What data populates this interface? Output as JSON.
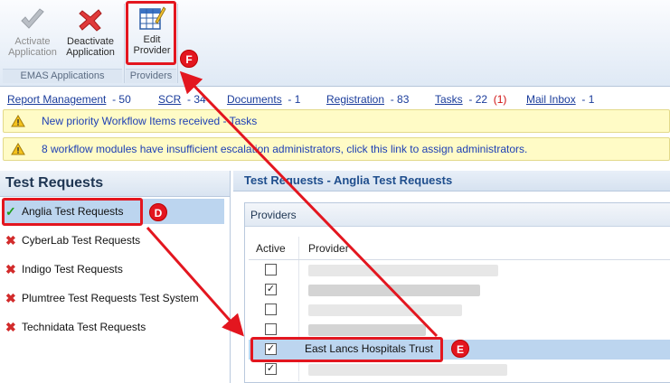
{
  "ribbon": {
    "activate_label_1": "Activate",
    "activate_label_2": "Application",
    "deactivate_label_1": "Deactivate",
    "deactivate_label_2": "Application",
    "edit_label_1": "Edit",
    "edit_label_2": "Provider",
    "group_emas": "EMAS Applications",
    "group_providers": "Providers"
  },
  "stats": [
    {
      "label": "Report Management",
      "count": "- 50"
    },
    {
      "label": "SCR",
      "count": "- 34"
    },
    {
      "label": "Documents",
      "count": "- 1"
    },
    {
      "label": "Registration",
      "count": "- 83"
    },
    {
      "label": "Tasks",
      "count": "- 22",
      "extra": "(1)"
    },
    {
      "label": "Mail Inbox",
      "count": "- 1"
    }
  ],
  "alerts": [
    "New priority Workflow Items received - Tasks",
    "8 workflow modules have insufficient escalation administrators, click this link to assign administrators."
  ],
  "left_panel": {
    "title": "Test Requests",
    "items": [
      {
        "label": "Anglia Test Requests",
        "status": "✓"
      },
      {
        "label": "CyberLab Test Requests",
        "status": "✖"
      },
      {
        "label": "Indigo Test Requests",
        "status": "✖"
      },
      {
        "label": "Plumtree Test Requests Test System",
        "status": "✖"
      },
      {
        "label": "Technidata Test Requests",
        "status": "✖"
      }
    ]
  },
  "right_panel": {
    "header": "Test Requests - Anglia Test Requests",
    "providers_title": "Providers",
    "col_active": "Active",
    "col_provider": "Provider",
    "rows": [
      {
        "checked": false,
        "name": ""
      },
      {
        "checked": true,
        "name": ""
      },
      {
        "checked": false,
        "name": ""
      },
      {
        "checked": false,
        "name": ""
      },
      {
        "checked": true,
        "name": "East Lancs Hospitals Trust"
      },
      {
        "checked": true,
        "name": ""
      }
    ],
    "check_glyph": "✓"
  },
  "markers": {
    "d": "D",
    "e": "E",
    "f": "F"
  },
  "colors": {
    "annotation_red": "#e3161f",
    "selection_blue": "#bcd5ef",
    "link_blue": "#1a3c9b"
  }
}
